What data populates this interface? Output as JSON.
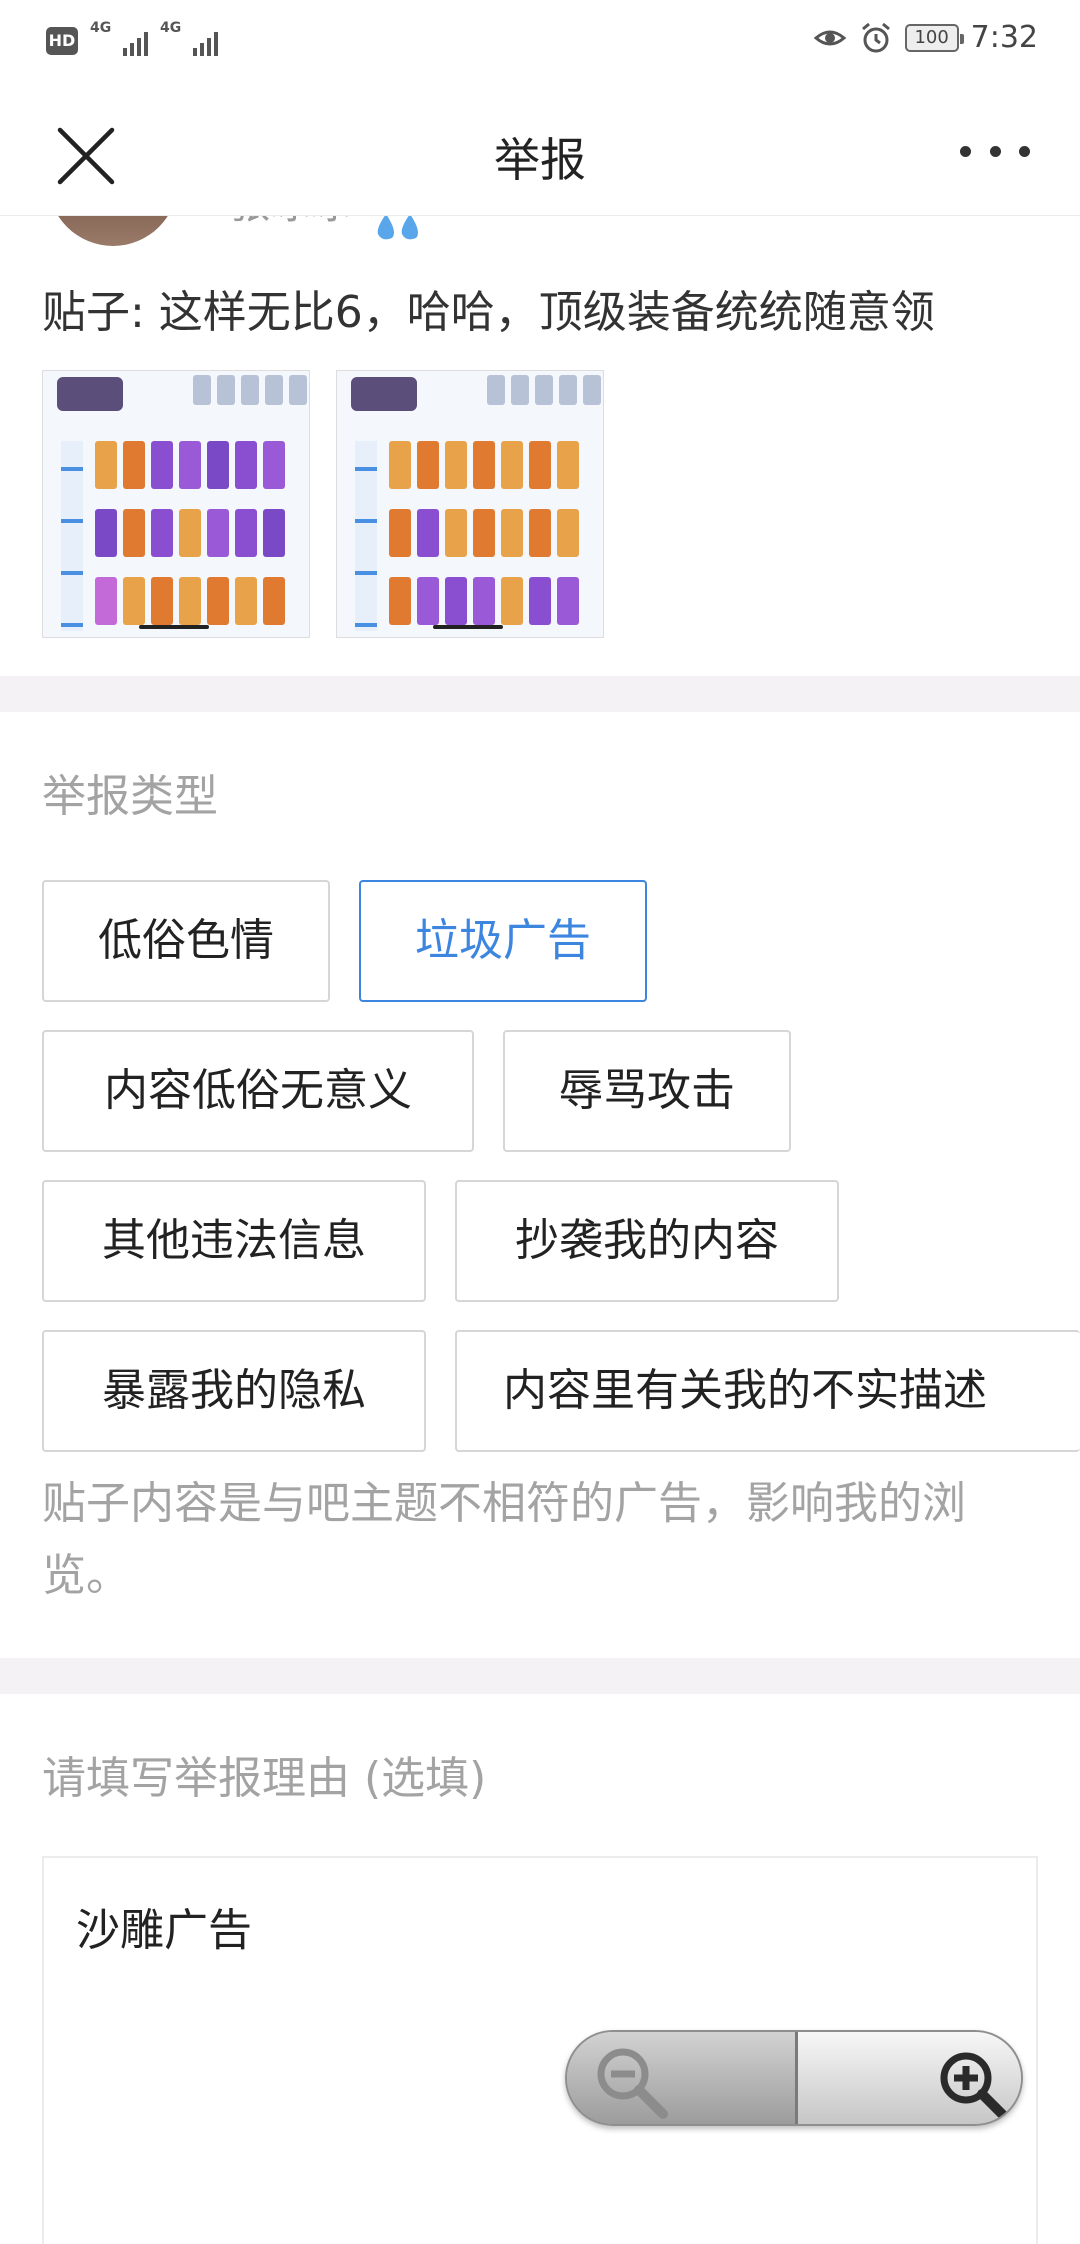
{
  "status_bar": {
    "hd_label": "HD",
    "network_1": "4G",
    "network_2": "4G",
    "battery": "100",
    "time": "7:32"
  },
  "header": {
    "title": "举报",
    "close_icon": "close-icon",
    "more_icon": "more-icon"
  },
  "post": {
    "author": "张冰冰",
    "text": "贴子: 这样无比6，哈哈，顶级装备统统随意领"
  },
  "report_type": {
    "title": "举报类型",
    "options": [
      {
        "label": "低俗色情",
        "selected": false
      },
      {
        "label": "垃圾广告",
        "selected": true
      },
      {
        "label": "内容低俗无意义",
        "selected": false
      },
      {
        "label": "辱骂攻击",
        "selected": false
      },
      {
        "label": "其他违法信息",
        "selected": false
      },
      {
        "label": "抄袭我的内容",
        "selected": false
      },
      {
        "label": "暴露我的隐私",
        "selected": false
      },
      {
        "label": "内容里有关我的不实描述",
        "selected": false
      }
    ],
    "description": "贴子内容是与吧主题不相符的广告，影响我的浏览。"
  },
  "reason": {
    "title": "请填写举报理由 (选填)",
    "value": "沙雕广告"
  },
  "zoom_control": {
    "out_icon": "zoom-out-icon",
    "in_icon": "zoom-in-icon"
  },
  "colors": {
    "accent": "#3d86e0",
    "muted_text": "#a3a3a3",
    "divider_band": "#f5f2f5"
  }
}
